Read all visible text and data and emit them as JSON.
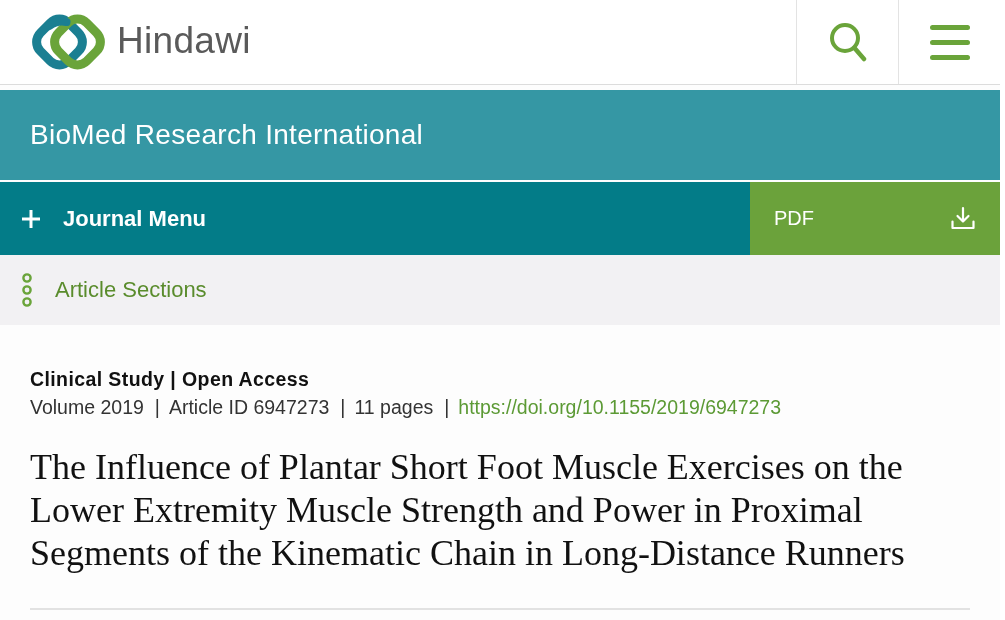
{
  "header": {
    "logo_text": "Hindawi"
  },
  "journal": {
    "title": "BioMed Research International"
  },
  "nav": {
    "journal_menu": {
      "label": "Journal Menu",
      "expanded": false
    },
    "pdf": {
      "label": "PDF"
    }
  },
  "article_sections": {
    "label": "Article Sections"
  },
  "article": {
    "category_line": "Clinical Study | Open Access",
    "meta": [
      {
        "kind": "text",
        "text": "Volume 2019"
      },
      {
        "kind": "separator",
        "text": "|"
      },
      {
        "kind": "text",
        "text": "Article ID 6947273"
      },
      {
        "kind": "separator",
        "text": "|"
      },
      {
        "kind": "text",
        "text": "11 pages"
      },
      {
        "kind": "separator",
        "text": "|"
      },
      {
        "kind": "link",
        "text": "https://doi.org/10.1155/2019/6947273"
      }
    ],
    "title": "The Influence of Plantar Short Foot Muscle Exercises on the Lower Extremity Muscle Strength and Power in Proximal Segments of the Kinematic Chain in Long-Distance Runners"
  }
}
